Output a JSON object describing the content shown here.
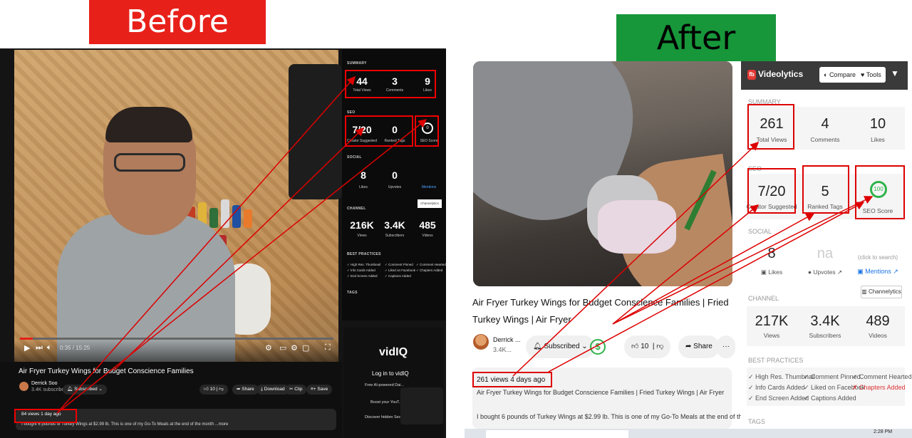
{
  "banners": {
    "before": {
      "label": "Before",
      "bg": "#e8201a",
      "color": "#ffffff"
    },
    "after": {
      "label": "After",
      "bg": "#17963a",
      "color": "#000000"
    }
  },
  "before": {
    "player": {
      "time": "0:35 / 15:25",
      "progress": 0.04
    },
    "video_title": "Air Fryer Turkey Wings for Budget Conscience Families",
    "channel": {
      "name": "Derrick Soo",
      "subs": "3.4K subscribers"
    },
    "buttons": {
      "subscribed": "Subscribed",
      "likes": "10",
      "share": "Share",
      "download": "Download",
      "clip": "Clip",
      "save": "Save"
    },
    "views": "84 views  1 day ago",
    "description": "I bought 6 pounds of Turkey Wings at $2.99 lb. This is one of my Go-To Meals at the end of the month ...more",
    "panel": {
      "summary_label": "SUMMARY",
      "total_views": "44",
      "total_views_label": "Total Views",
      "comments": "3",
      "comments_label": "Comments",
      "likes": "9",
      "likes_label": "Likes",
      "seo_label": "SEO",
      "creator_suggested": "7/20",
      "creator_suggested_label": "Creator Suggested",
      "ranked_tags": "0",
      "ranked_tags_label": "Ranked Tags",
      "seo_score": "0",
      "seo_score_label": "SEO Score",
      "social_label": "SOCIAL",
      "social_likes": "8",
      "social_likes_label": "Likes",
      "upvotes": "0",
      "upvotes_label": "Upvotes",
      "mentions_label": "Mentions",
      "channelytics": "Channelytics",
      "channel_label": "CHANNEL",
      "views": "216K",
      "views_label": "Views",
      "subscribers": "3.4K",
      "subscribers_label": "Subscribers",
      "videos": "485",
      "videos_label": "Videos",
      "best_practices_label": "BEST PRACTICES",
      "bp": [
        "✓ High Res. Thumbnail",
        "✓ Comment Pinned",
        "✓ Comment Hearted",
        "✓ Info Cards Added",
        "✓ Liked on Facebook",
        "✓ Chapters Added",
        "✓ End Screen Added",
        "✓ Captions Added"
      ],
      "tags_label": "TAGS"
    },
    "vidiq": {
      "logo": "vidIQ",
      "login": "Log in to vidIQ",
      "items": [
        "Free AI-powered Dai...",
        "Boost your YouT...",
        "Discover hidden Secr..."
      ]
    }
  },
  "after": {
    "video_title": "Air Fryer Turkey Wings for Budget Conscience Families | Fried Turkey Wings | Air Fryer",
    "channel": {
      "name": "Derrick ...",
      "subs": "3.4K..."
    },
    "buttons": {
      "subscribed": "Subscribed",
      "likes": "10",
      "share": "Share",
      "more": "···"
    },
    "views": "261 views  4 days ago",
    "desc_title": "Air Fryer Turkey Wings for Budget Conscience Families | Fried Turkey Wings | Air Fryer",
    "description": "I bought 6 pounds of Turkey Wings at $2.99 lb. This is one of my Go-To Meals at the end of the mo ...more",
    "panel": {
      "brand": "Videolytics",
      "compare": "Compare",
      "tools": "Tools",
      "summary_label": "SUMMARY",
      "total_views": "261",
      "total_views_label": "Total Views",
      "comments": "4",
      "comments_label": "Comments",
      "likes": "10",
      "likes_label": "Likes",
      "seo_label": "SEO",
      "creator_suggested": "7/20",
      "creator_suggested_label": "Creator Suggested",
      "ranked_tags": "5",
      "ranked_tags_label": "Ranked Tags",
      "seo_score": "100",
      "seo_score_label": "SEO Score",
      "social_label": "SOCIAL",
      "social_likes": "8",
      "social_likes_label": "Likes",
      "upvotes": "na",
      "upvotes_label": "Upvotes",
      "mentions_hint": "(click to search)",
      "mentions_label": "Mentions",
      "channelytics": "Channelytics",
      "channel_label": "CHANNEL",
      "views": "217K",
      "views_label": "Views",
      "subscribers": "3.4K",
      "subscribers_label": "Subscribers",
      "videos": "489",
      "videos_label": "Videos",
      "best_practices_label": "BEST PRACTICES",
      "bp": [
        "✓ High Res. Thumbnail",
        "✓ Comment Pinned",
        "✓ Comment Hearted",
        "✓ Info Cards Added",
        "✓ Liked on Facebook",
        "✗ Chapters Added",
        "✓ End Screen Added",
        "✓ Captions Added"
      ],
      "tags_label": "TAGS"
    },
    "taskbar_time": "2:28 PM"
  },
  "colors": {
    "highlight": "#dd0000",
    "seo_green": "#2eb34a",
    "brand_red": "#e53935"
  }
}
